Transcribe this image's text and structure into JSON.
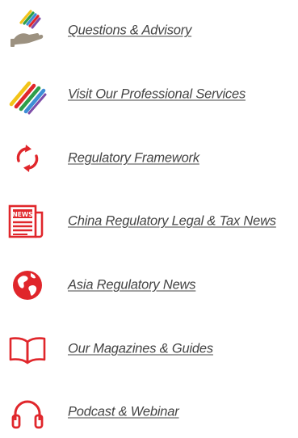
{
  "colors": {
    "accent_red": "#e0262b",
    "text": "#444444"
  },
  "menu": {
    "items": [
      {
        "label": "Questions & Advisory",
        "icon": "advisory-hand-pencils-icon"
      },
      {
        "label": "Visit Our Professional Services",
        "icon": "colored-pencils-icon"
      },
      {
        "label": "Regulatory Framework",
        "icon": "refresh-arrows-icon"
      },
      {
        "label": "China Regulatory Legal & Tax News",
        "icon": "newspaper-icon"
      },
      {
        "label": "Asia Regulatory News ",
        "icon": "globe-icon"
      },
      {
        "label": "Our Magazines & Guides",
        "icon": "open-book-icon"
      },
      {
        "label": "Podcast & Webinar",
        "icon": "headphones-icon"
      }
    ]
  }
}
